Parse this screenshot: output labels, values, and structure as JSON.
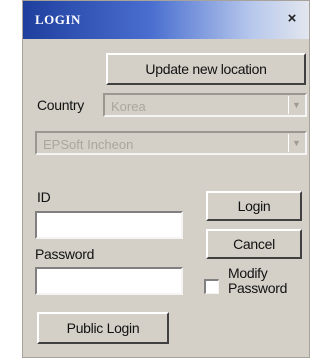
{
  "window": {
    "title": "LOGIN",
    "close_glyph": "×"
  },
  "buttons": {
    "update_location": "Update new location",
    "login": "Login",
    "cancel": "Cancel",
    "public_login": "Public Login"
  },
  "country": {
    "label": "Country",
    "value": "Korea"
  },
  "server": {
    "value": "EPSoft Incheon"
  },
  "fields": {
    "id_label": "ID",
    "id_value": "",
    "password_label": "Password",
    "password_value": ""
  },
  "modify_password": {
    "label_line1": "Modify",
    "label_line2": "Password",
    "checked": false
  },
  "icons": {
    "close": "close-icon",
    "dropdown": "chevron-down-icon"
  }
}
